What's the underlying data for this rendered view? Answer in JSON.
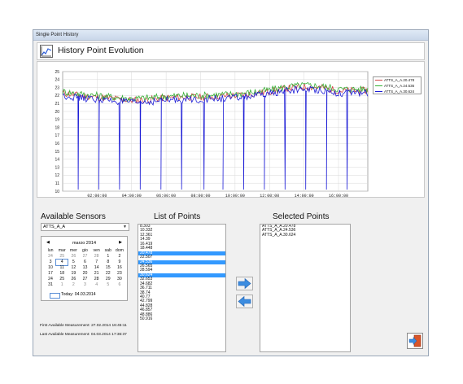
{
  "window": {
    "title": "Single Point History"
  },
  "header": {
    "title": "History Point Evolution",
    "icon": "line-chart-icon"
  },
  "chart_data": {
    "type": "line",
    "title": "",
    "xlabel": "",
    "ylabel": "",
    "x_ticks": [
      "02:00:00",
      "04:00:00",
      "06:00:00",
      "08:00:00",
      "10:00:00",
      "12:00:00",
      "14:00:00",
      "16:00:00"
    ],
    "y_ticks": [
      10,
      11,
      12,
      13,
      14,
      15,
      16,
      17,
      18,
      19,
      20,
      21,
      22,
      23,
      24,
      25
    ],
    "ylim": [
      10,
      25
    ],
    "xlim_hours": [
      0,
      17.7
    ],
    "grid": true,
    "legend_position": "right",
    "series": [
      {
        "name": "ATTS_A_A.20.478",
        "color": "#d04545",
        "x_hours": [
          0,
          1,
          2,
          3,
          4,
          5,
          6,
          7,
          8,
          9,
          10,
          11,
          12,
          13,
          14,
          15,
          16,
          17.7
        ],
        "values": [
          22.3,
          22.0,
          21.8,
          21.6,
          21.4,
          21.5,
          21.7,
          21.8,
          21.8,
          21.9,
          22.0,
          22.2,
          22.5,
          22.9,
          23.1,
          23.0,
          22.6,
          22.6
        ]
      },
      {
        "name": "ATTS_A_A.24.536",
        "color": "#33b033",
        "x_hours": [
          0,
          1,
          2,
          3,
          4,
          5,
          6,
          7,
          8,
          9,
          10,
          11,
          12,
          13,
          14,
          15,
          16,
          17.7
        ],
        "values": [
          22.5,
          22.2,
          22.0,
          21.8,
          21.6,
          21.7,
          21.9,
          22.0,
          22.0,
          22.1,
          22.2,
          22.4,
          22.7,
          23.1,
          23.3,
          23.2,
          22.8,
          22.8
        ]
      },
      {
        "name": "ATTS_A_A.30.624",
        "color": "#1c1cd6",
        "x_hours": [
          0,
          1,
          2,
          3,
          4,
          5,
          6,
          7,
          8,
          9,
          10,
          11,
          12,
          13,
          14,
          15,
          16,
          17.7
        ],
        "values": [
          22.0,
          21.7,
          21.5,
          21.3,
          21.1,
          21.2,
          21.4,
          21.5,
          21.5,
          21.6,
          21.7,
          21.9,
          22.2,
          22.6,
          22.8,
          22.7,
          22.3,
          22.3
        ],
        "dips_x_hours": [
          0.9,
          2.1,
          3.3,
          4.5,
          5.7,
          6.9,
          8.2,
          9.3,
          10.5,
          11.7,
          12.9,
          14.1,
          15.3,
          16.5
        ],
        "dip_value": 10.2
      }
    ]
  },
  "sensors": {
    "title": "Available Sensors",
    "selected": "ATTS_A_A"
  },
  "calendar": {
    "month_label": "marzo 2014",
    "weekdays": [
      "lun",
      "mar",
      "mer",
      "gio",
      "ven",
      "sab",
      "dom"
    ],
    "weeks": [
      [
        "24",
        "25",
        "26",
        "27",
        "28",
        "1",
        "2"
      ],
      [
        "3",
        "4",
        "5",
        "6",
        "7",
        "8",
        "9"
      ],
      [
        "10",
        "11",
        "12",
        "13",
        "14",
        "15",
        "16"
      ],
      [
        "17",
        "18",
        "19",
        "20",
        "21",
        "22",
        "23"
      ],
      [
        "24",
        "25",
        "26",
        "27",
        "28",
        "29",
        "30"
      ],
      [
        "31",
        "1",
        "2",
        "3",
        "4",
        "5",
        "6"
      ]
    ],
    "today_label": "Today: 04.03.2014"
  },
  "measurements": {
    "first": "First Available Measurement: 27.02.2014 16:45:11",
    "last": "Last Available Measurement: 04.03.2014 17:36:37"
  },
  "points": {
    "title": "List of Points",
    "items": [
      "8.303",
      "10.332",
      "12.361",
      "14.39",
      "16.419",
      "18.448",
      "20.478",
      "22.507",
      "24.536",
      "26.565",
      "28.594",
      "30.624",
      "32.653",
      "34.682",
      "36.711",
      "38.74",
      "40.77",
      "42.799",
      "44.828",
      "46.857",
      "48.886",
      "50.916"
    ],
    "selected_indices": [
      6,
      8,
      11
    ]
  },
  "selected_points": {
    "title": "Selected Points",
    "items": [
      "ATTS_A_A.20.478",
      "ATTS_A_A.24.536",
      "ATTS_A_A.30.624"
    ]
  },
  "buttons": {
    "add_icon": "arrow-right-icon",
    "remove_icon": "arrow-left-icon",
    "exit_icon": "exit-door-icon"
  }
}
